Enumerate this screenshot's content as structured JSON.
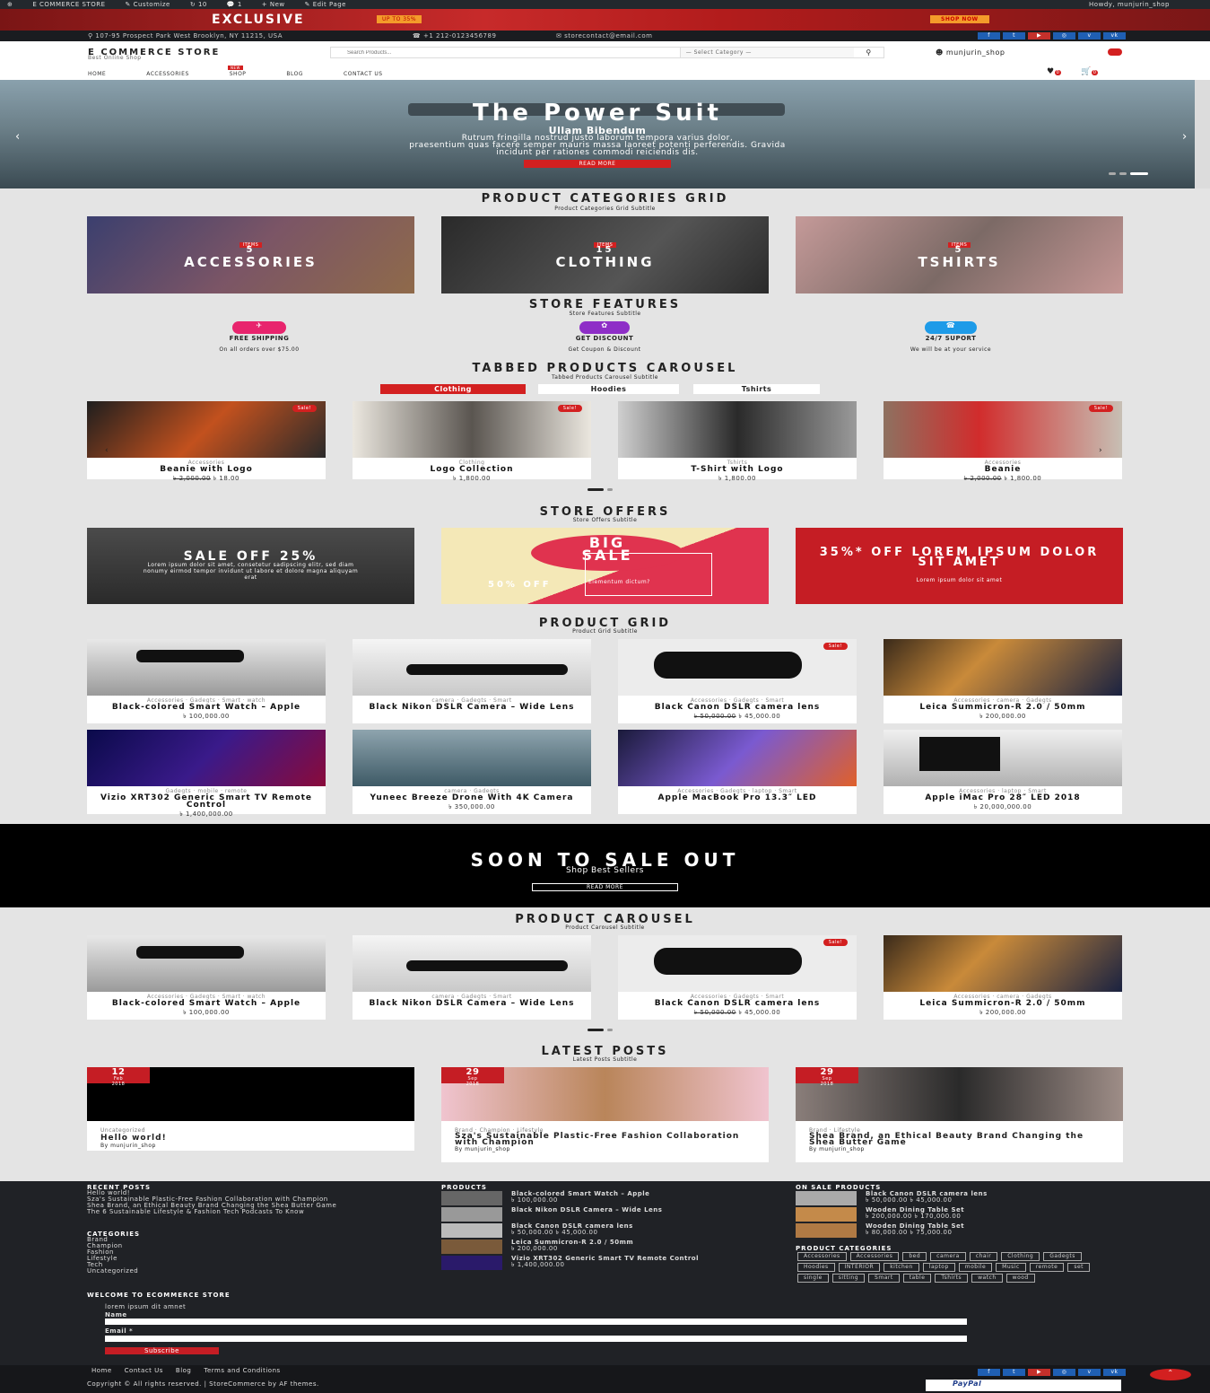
{
  "adminbar": {
    "site": "E COMMERCE STORE",
    "customize": "Customize",
    "comments": "10",
    "updates": "1",
    "new": "New",
    "edit": "Edit Page",
    "howdy": "Howdy, munjurin_shop"
  },
  "promo": {
    "exclusive": "EXCLUSIVE",
    "upto": "UP TO 35%",
    "shop_now": "SHOP NOW"
  },
  "info": {
    "address": "107-95 Prospect Park West Brooklyn, NY 11215, USA",
    "phone": "+1 212-0123456789",
    "email": "storecontact@email.com"
  },
  "header": {
    "store": "E COMMERCE STORE",
    "tagline": "Best Online Shop",
    "search_placeholder": "Search Products...",
    "category": "— Select Category —",
    "user": "munjurin_shop",
    "wish_count": "0",
    "cart_count": "0"
  },
  "nav": [
    "HOME",
    "ACCESSORIES",
    "SHOP",
    "BLOG",
    "CONTACT US"
  ],
  "nav_badge": "NEW",
  "hero": {
    "title": "The Power Suit",
    "sub": "Ullam Bibendum",
    "text1": "Rutrum fringilla nostrud justo laborum tempora varius dolor,",
    "text2": "praesentium quas facere semper mauris massa laoreet potenti perferendis. Gravida",
    "text3": "incidunt per rationes commodi reiciendis dis.",
    "btn": "READ MORE"
  },
  "sections": {
    "cat_title": "PRODUCT CATEGORIES GRID",
    "cat_sub": "Product Categories Grid Subtitle",
    "feat_title": "STORE FEATURES",
    "feat_sub": "Store Features Subtitle",
    "tab_title": "TABBED PRODUCTS CAROUSEL",
    "tab_sub": "Tabbed Products Carousel Subtitle",
    "off_title": "STORE OFFERS",
    "off_sub": "Store Offers Subtitle",
    "grid_title": "PRODUCT GRID",
    "grid_sub": "Product Grid Subtitle",
    "car_title": "PRODUCT CAROUSEL",
    "car_sub": "Product Carousel Subtitle",
    "posts_title": "LATEST POSTS",
    "posts_sub": "Latest Posts Subtitle"
  },
  "categories": [
    {
      "items": "ITEMS",
      "count": "5",
      "name": "ACCESSORIES"
    },
    {
      "items": "ITEMS",
      "count": "15",
      "name": "CLOTHING"
    },
    {
      "items": "ITEMS",
      "count": "5",
      "name": "TSHIRTS"
    }
  ],
  "features": [
    {
      "t": "FREE SHIPPING",
      "s": "On all orders over $75.00"
    },
    {
      "t": "GET DISCOUNT",
      "s": "Get Coupon & Discount"
    },
    {
      "t": "24/7 SUPORT",
      "s": "We will be at your service"
    }
  ],
  "tabs": [
    "Clothing",
    "Hoodies",
    "Tshirts"
  ],
  "sale_badge": "Sale!",
  "tabbed": [
    {
      "meta": "Accessories",
      "nm": "Beanie with Logo",
      "old": "৳ 2,000.00",
      "pr": "৳ 18.00"
    },
    {
      "meta": "Clothing",
      "nm": "Logo Collection",
      "old": "",
      "pr": "৳ 1,800.00"
    },
    {
      "meta": "Tshirts",
      "nm": "T-Shirt with Logo",
      "old": "",
      "pr": "৳ 1,800.00"
    },
    {
      "meta": "Accessories",
      "nm": "Beanie",
      "old": "৳ 2,000.00",
      "pr": "৳ 1,800.00"
    }
  ],
  "offers": {
    "o1": "SALE OFF 25%",
    "o1s": "Lorem ipsum dolor sit amet, consetetur sadipscing elitr, sed diam nonumy eirmod tempor invidunt ut labore et dolore magna aliquyam erat",
    "o2a": "BIG",
    "o2b": "SALE",
    "o2c": "50% OFF",
    "o2d": "Elementum dictum?",
    "o3": "35%* OFF LOREM IPSUM DOLOR SIT AMET",
    "o3s": "Lorem ipsum dolor sit amet"
  },
  "grid": [
    {
      "meta": "Accessories · Gadegts · Smart · watch",
      "nm": "Black-colored Smart Watch – Apple",
      "old": "",
      "pr": "৳ 100,000.00"
    },
    {
      "meta": "camera · Gadegts · Smart",
      "nm": "Black Nikon DSLR Camera – Wide Lens",
      "old": "",
      "pr": ""
    },
    {
      "meta": "Accessories · Gadegts · Smart",
      "nm": "Black Canon DSLR camera lens",
      "old": "৳ 50,000.00",
      "pr": "৳ 45,000.00"
    },
    {
      "meta": "Accessories · camera · Gadegts",
      "nm": "Leica Summicron-R 2.0 / 50mm",
      "old": "",
      "pr": "৳ 200,000.00"
    },
    {
      "meta": "Gadegts · mobile · remote",
      "nm": "Vizio XRT302 Generic Smart TV Remote Control",
      "old": "",
      "pr": "৳ 1,400,000.00"
    },
    {
      "meta": "camera · Gadegts",
      "nm": "Yuneec Breeze Drone With 4K Camera",
      "old": "",
      "pr": "৳ 350,000.00"
    },
    {
      "meta": "Accessories · Gadegts · laptop · Smart",
      "nm": "Apple MacBook Pro 13.3″ LED",
      "old": "",
      "pr": ""
    },
    {
      "meta": "Accessories · laptop · Smart",
      "nm": "Apple iMac Pro 28″ LED 2018",
      "old": "",
      "pr": "৳ 20,000,000.00"
    }
  ],
  "soon": {
    "title": "SOON TO SALE OUT",
    "sub": "Shop Best Sellers",
    "btn": "READ MORE"
  },
  "posts": [
    {
      "day": "12",
      "mon": "Feb",
      "yr": "2018",
      "cats": "Uncategorized",
      "nm": "Hello world!",
      "by": "By munjurin_shop"
    },
    {
      "day": "29",
      "mon": "Sep",
      "yr": "2018",
      "cats": "Brand · Champion · Lifestyle",
      "nm": "Sza's Sustainable Plastic-Free Fashion Collaboration with Champion",
      "by": "By munjurin_shop"
    },
    {
      "day": "29",
      "mon": "Sep",
      "yr": "2018",
      "cats": "Brand · Lifestyle",
      "nm": "Shea Brand, an Ethical Beauty Brand Changing the Shea Butter Game",
      "by": "By munjurin_shop"
    }
  ],
  "footer": {
    "recent_h": "RECENT POSTS",
    "recent": [
      "Hello world!",
      "Sza's Sustainable Plastic-Free Fashion Collaboration with Champion",
      "Shea Brand, an Ethical Beauty Brand Changing the Shea Butter Game",
      "The 6 Sustainable Lifestyle & Fashion Tech Podcasts To Know"
    ],
    "cat_h": "CATEGORIES",
    "cats": [
      "Brand",
      "Champion",
      "Fashion",
      "Lifestyle",
      "Tech",
      "Uncategorized"
    ],
    "prod_h": "PRODUCTS",
    "prods": [
      {
        "n": "Black-colored Smart Watch – Apple",
        "p": "৳ 100,000.00"
      },
      {
        "n": "Black Nikon DSLR Camera – Wide Lens",
        "p": ""
      },
      {
        "n": "Black Canon DSLR camera lens",
        "p": "৳ 50,000.00 ৳ 45,000.00"
      },
      {
        "n": "Leica Summicron-R 2.0 / 50mm",
        "p": "৳ 200,000.00"
      },
      {
        "n": "Vizio XRT302 Generic Smart TV Remote Control",
        "p": "৳ 1,400,000.00"
      }
    ],
    "sale_h": "ON SALE PRODUCTS",
    "sale": [
      {
        "n": "Black Canon DSLR camera lens",
        "p": "৳ 50,000.00 ৳ 45,000.00"
      },
      {
        "n": "Wooden Dining Table Set",
        "p": "৳ 200,000.00 ৳ 170,000.00"
      },
      {
        "n": "Wooden Dining Table Set",
        "p": "৳ 80,000.00 ৳ 75,000.00"
      }
    ],
    "pcat_h": "PRODUCT CATEGORIES",
    "tags": [
      "Accessories",
      "Accessories",
      "bed",
      "camera",
      "chair",
      "Clothing",
      "Gadegts",
      "Hoodies",
      "INTERIOR",
      "kitchen",
      "laptop",
      "mobile",
      "Music",
      "remote",
      "set",
      "single",
      "sitting",
      "Smart",
      "table",
      "Tshirts",
      "watch",
      "wood"
    ],
    "welcome_h": "WELCOME TO ECOMMERCE STORE",
    "welcome_t": "lorem ipsum dit amnet",
    "name_l": "Name",
    "email_l": "Email *",
    "subscribe": "Subscribe",
    "links": [
      "Home",
      "Contact Us",
      "Blog",
      "Terms and Conditions"
    ],
    "copy": "Copyright © All rights reserved. | StoreCommerce by AF themes.",
    "paypal": "PayPal"
  }
}
